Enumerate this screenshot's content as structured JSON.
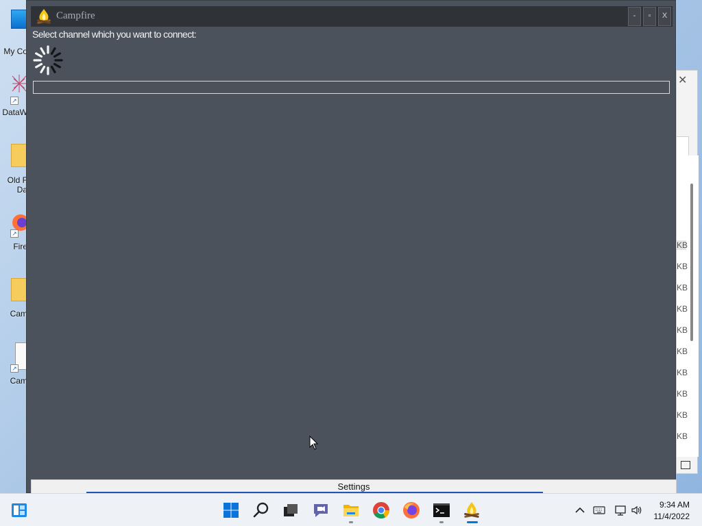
{
  "desktop": {
    "icons": [
      {
        "label": "My Co",
        "icon": "computer-icon"
      },
      {
        "label": "DataW",
        "icon": "datawarrior-icon"
      },
      {
        "label": "Old F",
        "label2": "Da",
        "icon": "folder-icon"
      },
      {
        "label": "Fire",
        "icon": "firefox-icon"
      },
      {
        "label": "Cam",
        "icon": "folder-icon"
      },
      {
        "label": "Cam",
        "icon": "file-icon"
      }
    ],
    "shortcut_arrow": "↗"
  },
  "background_window": {
    "close_glyph": "✕",
    "sizes": [
      "KB",
      "KB",
      "KB",
      "KB",
      "KB",
      "KB",
      "KB",
      "KB",
      "KB",
      "KB"
    ]
  },
  "app": {
    "title": "Campfire",
    "logo": "campfire-icon",
    "minimize": "-",
    "maximize": "▫",
    "close": "X",
    "prompt": "Select channel which you want to connect:",
    "channel_input_value": "",
    "settings_label": "Settings",
    "status": "loading"
  },
  "taskbar": {
    "apps": [
      "start-icon",
      "search-icon",
      "task-view-icon",
      "chat-icon",
      "file-explorer-icon",
      "chrome-icon",
      "firefox-icon",
      "terminal-icon",
      "campfire-icon"
    ],
    "tray": [
      "chevron-up-icon",
      "keyboard-icon",
      "network-icon",
      "volume-icon"
    ],
    "time": "9:34 AM",
    "date": "11/4/2022"
  },
  "colors": {
    "app_background": "#4b525c",
    "titlebar": "#2f3338",
    "accent": "#0078d4"
  }
}
